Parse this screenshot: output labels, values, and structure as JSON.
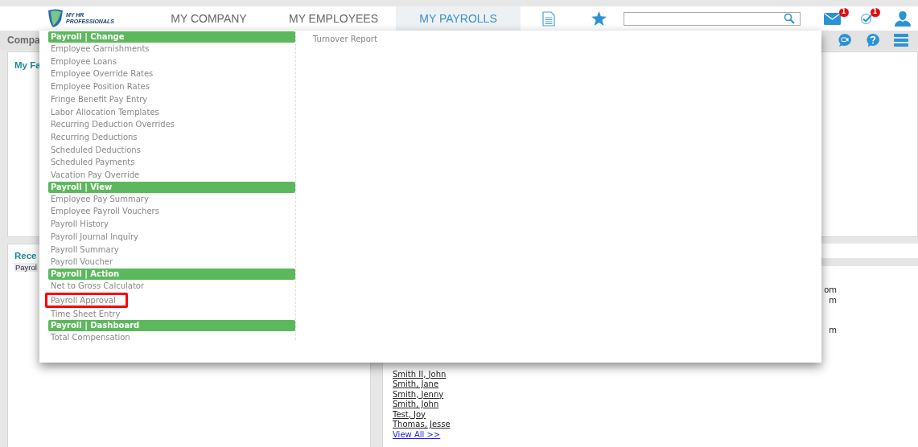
{
  "header": {
    "logo": {
      "line_1": "MY HR",
      "line_2": "PROFESSIONALS"
    },
    "nav": [
      {
        "label": "MY COMPANY",
        "selected": false
      },
      {
        "label": "MY EMPLOYEES",
        "selected": false
      },
      {
        "label": "MY PAYROLLS",
        "selected": true
      }
    ],
    "mail_badge": "1",
    "tasks_badge": "1"
  },
  "subbar": {
    "title": "Compa"
  },
  "top_panel": {
    "title": "My Fa"
  },
  "recent_panel": {
    "title": "Rece",
    "tag": "Payrol"
  },
  "employees_panel": {
    "fragments": [
      "om",
      "m",
      "m"
    ],
    "names": [
      "Smith II, John",
      "Smith, Jane",
      "Smith, Jenny",
      "Smith, John",
      "Test, Joy",
      "Thomas, Jesse"
    ],
    "view_all": "View All >>"
  },
  "menu": {
    "columns": [
      {
        "sections": [
          {
            "title": "Payroll | Change",
            "items": [
              {
                "label": "Employee Garnishments",
                "highlighted": false
              },
              {
                "label": "Employee Loans",
                "highlighted": false
              },
              {
                "label": "Employee Override Rates",
                "highlighted": false
              },
              {
                "label": "Employee Position Rates",
                "highlighted": false
              },
              {
                "label": "Fringe Benefit Pay Entry",
                "highlighted": false
              },
              {
                "label": "Labor Allocation Templates",
                "highlighted": false
              },
              {
                "label": "Recurring Deduction Overrides",
                "highlighted": false
              },
              {
                "label": "Recurring Deductions",
                "highlighted": false
              },
              {
                "label": "Scheduled Deductions",
                "highlighted": false
              },
              {
                "label": "Scheduled Payments",
                "highlighted": false
              },
              {
                "label": "Vacation Pay Override",
                "highlighted": false
              }
            ]
          },
          {
            "title": "Payroll | View",
            "items": [
              {
                "label": "Employee Pay Summary",
                "highlighted": false
              },
              {
                "label": "Employee Payroll Vouchers",
                "highlighted": false
              },
              {
                "label": "Payroll History",
                "highlighted": false
              },
              {
                "label": "Payroll Journal Inquiry",
                "highlighted": false
              },
              {
                "label": "Payroll Summary",
                "highlighted": false
              },
              {
                "label": "Payroll Voucher",
                "highlighted": false
              }
            ]
          },
          {
            "title": "Payroll | Action",
            "items": [
              {
                "label": "Net to Gross Calculator",
                "highlighted": false
              },
              {
                "label": "Payroll Approval",
                "highlighted": true
              },
              {
                "label": "Time Sheet Entry",
                "highlighted": false
              }
            ]
          },
          {
            "title": "Payroll | Dashboard",
            "items": [
              {
                "label": "Total Compensation",
                "highlighted": false
              }
            ]
          }
        ]
      },
      {
        "sections": [
          {
            "items": [
              {
                "label": "Turnover Report",
                "highlighted": false
              }
            ]
          }
        ]
      }
    ]
  }
}
